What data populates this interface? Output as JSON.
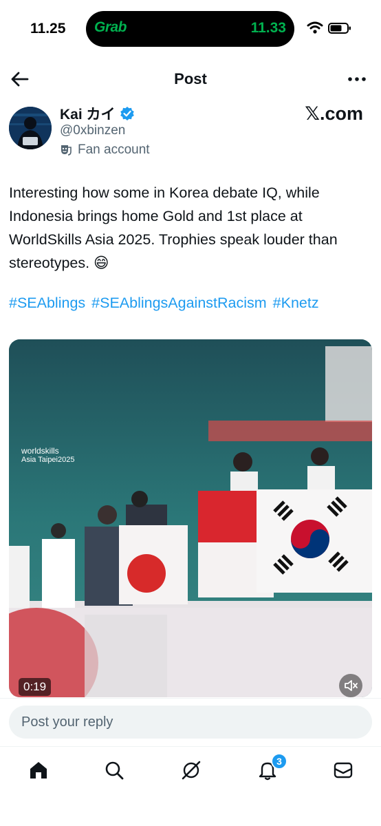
{
  "status_bar": {
    "time": "11.25",
    "island_app": "Grab",
    "island_eta": "11.33",
    "icons": [
      "wifi-icon",
      "battery-icon"
    ]
  },
  "header": {
    "title": "Post"
  },
  "author": {
    "name": "Kai カイ",
    "verified": true,
    "handle": "@0xbinzen",
    "label": "Fan account",
    "source_watermark": "𝕏.com"
  },
  "post": {
    "text": "Interesting how some in Korea debate IQ, while Indonesia brings home Gold and 1st place at WorldSkills Asia 2025. Trophies speak louder than stereotypes. 😄",
    "hashtags": [
      "#SEAblings",
      "#SEAblingsAgainstRacism",
      "#Knetz"
    ]
  },
  "media": {
    "duration": "0:19",
    "logo_line1": "worldskills",
    "logo_line2": "Asia Taipei2025"
  },
  "reply": {
    "placeholder": "Post your reply"
  },
  "tabbar": {
    "items": [
      "home-icon",
      "search-icon",
      "grok-icon",
      "notifications-icon",
      "messages-icon"
    ],
    "notification_count": "3"
  },
  "colors": {
    "accent": "#1d9bf0",
    "text": "#0f1419",
    "secondary": "#536471",
    "grab_green": "#00b14f"
  }
}
